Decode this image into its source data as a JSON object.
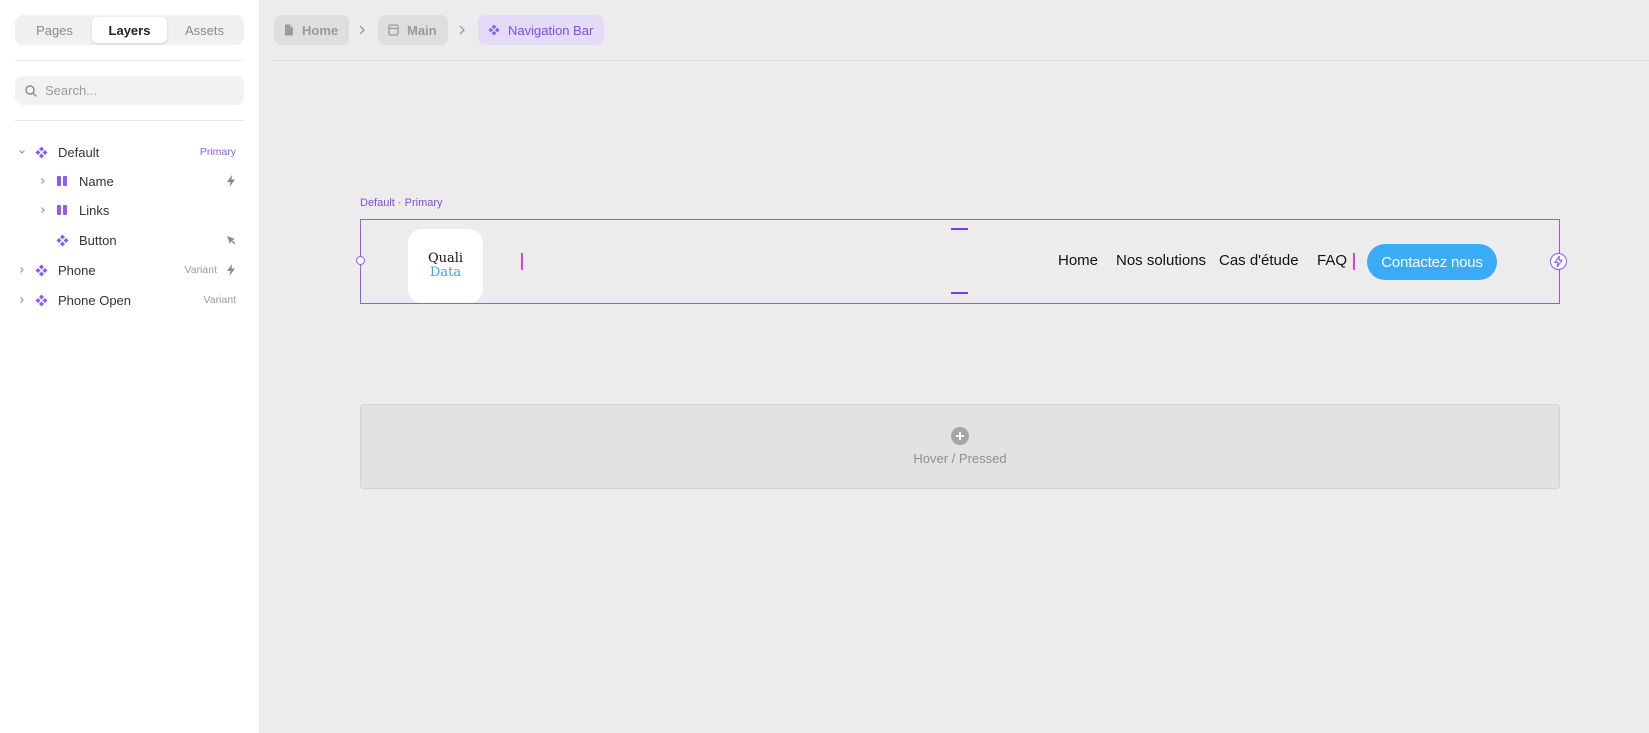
{
  "sidebar": {
    "tabs": [
      {
        "label": "Pages",
        "active": false
      },
      {
        "label": "Layers",
        "active": true
      },
      {
        "label": "Assets",
        "active": false
      }
    ],
    "search": {
      "placeholder": "Search..."
    },
    "layers": [
      {
        "name": "Default",
        "badge": "Primary",
        "icon": "component-icon",
        "expanded": true
      },
      {
        "name": "Name",
        "badge": "",
        "icon": "stack-icon",
        "right_icon": "bolt-icon"
      },
      {
        "name": "Links",
        "badge": "",
        "icon": "stack-icon"
      },
      {
        "name": "Button",
        "badge": "",
        "icon": "component-icon",
        "right_icon": "cursor-icon"
      },
      {
        "name": "Phone",
        "badge": "Variant",
        "icon": "component-icon",
        "right_icon": "bolt-icon"
      },
      {
        "name": "Phone Open",
        "badge": "Variant",
        "icon": "component-icon"
      }
    ]
  },
  "breadcrumbs": [
    {
      "label": "Home",
      "icon": "page-icon"
    },
    {
      "label": "Main",
      "icon": "frame-icon"
    },
    {
      "label": "Navigation Bar",
      "icon": "component-icon",
      "active": true
    }
  ],
  "canvas": {
    "frame_label": "Default · Primary",
    "logo": {
      "top": "Quali",
      "bottom": "Data"
    },
    "nav_links": [
      "Home",
      "Nos solutions",
      "Cas d'étude",
      "FAQ"
    ],
    "cta_label": "Contactez nous",
    "add_state_label": "Hover / Pressed"
  },
  "colors": {
    "accent": "#8b5cf6",
    "cta": "#3aabf7",
    "canvas_bg": "#ececed",
    "logo_blue": "#2ea7f0"
  }
}
